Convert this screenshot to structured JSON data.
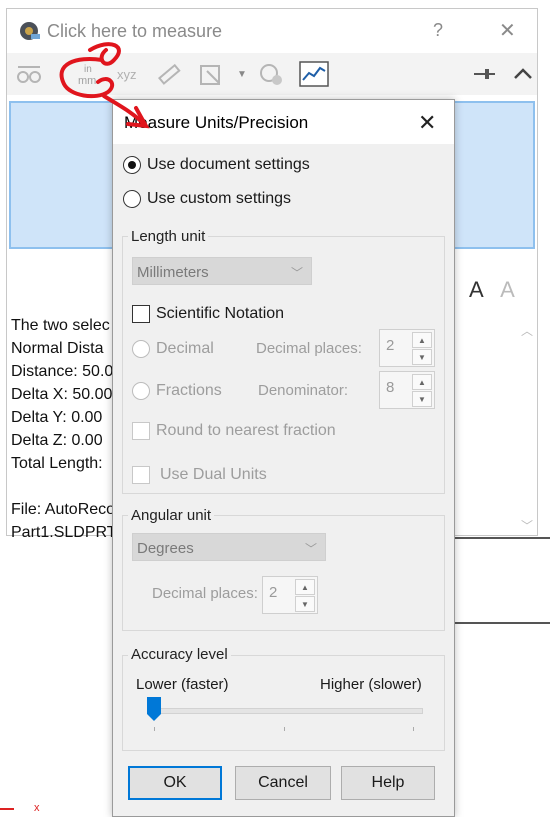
{
  "measure_window": {
    "title": "Click here to measure",
    "help_glyph": "?",
    "close_glyph": "✕",
    "toolbar": {
      "units_icon_text_top": "in",
      "units_icon_text_bottom": "mm",
      "xyz_icon_text": "xyz"
    },
    "results": [
      "The two selec",
      "Normal Dista",
      "Distance: 50.0",
      "Delta X: 50.00",
      "Delta Y: 0.00 ",
      "Delta Z: 0.00 ",
      "Total Length:",
      "",
      "File: AutoReco",
      "Part1.SLDPRT"
    ],
    "font_increase_label": "A",
    "font_decrease_label": "A"
  },
  "dialog": {
    "title": "Measure Units/Precision",
    "close_glyph": "✕",
    "settings_mode": {
      "use_document_settings": "Use document settings",
      "use_custom_settings": "Use custom settings",
      "selected": "use_document_settings"
    },
    "length_unit": {
      "group_label": "Length unit",
      "unit_value": "Millimeters",
      "scientific_notation_label": "Scientific Notation",
      "decimal_label": "Decimal",
      "decimal_places_label": "Decimal places:",
      "decimal_places_value": "2",
      "fractions_label": "Fractions",
      "denominator_label": "Denominator:",
      "denominator_value": "8",
      "round_label": "Round to nearest fraction",
      "dual_units_label": "Use Dual Units"
    },
    "angular_unit": {
      "group_label": "Angular unit",
      "unit_value": "Degrees",
      "decimal_places_label": "Decimal places:",
      "decimal_places_value": "2"
    },
    "accuracy": {
      "group_label": "Accuracy level",
      "low_label": "Lower (faster)",
      "high_label": "Higher (slower)",
      "level": 0
    },
    "buttons": {
      "ok": "OK",
      "cancel": "Cancel",
      "help": "Help"
    }
  },
  "colors": {
    "selection_box": "#cfe4f9",
    "accent": "#0078d7",
    "annotation_red": "#e0151d"
  },
  "other": {
    "corner_mark": "x"
  }
}
